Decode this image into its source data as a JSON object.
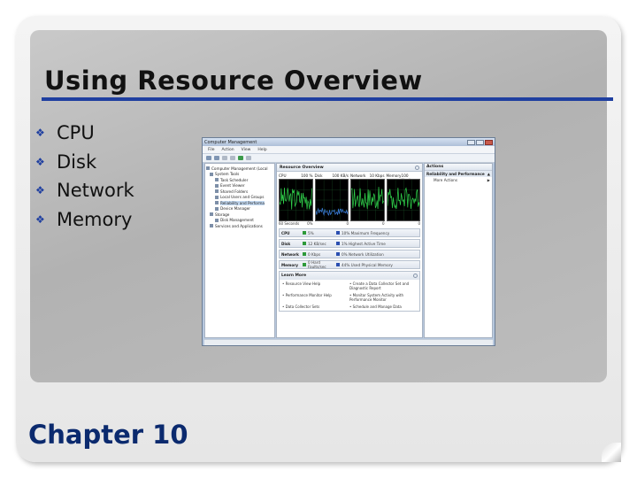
{
  "slide": {
    "title": "Using Resource Overview",
    "bullets": [
      "CPU",
      "Disk",
      "Network",
      "Memory"
    ],
    "footer": "Chapter 10"
  },
  "window": {
    "title": "Computer Management",
    "menus": [
      "File",
      "Action",
      "View",
      "Help"
    ],
    "tree": [
      {
        "label": "Computer Management (Local",
        "level": 0
      },
      {
        "label": "System Tools",
        "level": 1
      },
      {
        "label": "Task Scheduler",
        "level": 2
      },
      {
        "label": "Event Viewer",
        "level": 2
      },
      {
        "label": "Shared Folders",
        "level": 2
      },
      {
        "label": "Local Users and Groups",
        "level": 2
      },
      {
        "label": "Reliability and Performa",
        "level": 2,
        "selected": true
      },
      {
        "label": "Device Manager",
        "level": 2
      },
      {
        "label": "Storage",
        "level": 1
      },
      {
        "label": "Disk Management",
        "level": 2
      },
      {
        "label": "Services and Applications",
        "level": 1
      }
    ],
    "overview": {
      "header": "Resource Overview",
      "graphs": [
        {
          "name": "CPU",
          "value": "100 %",
          "foot_left": "60 Seconds",
          "foot_right": "0%"
        },
        {
          "name": "Disk",
          "value": "100 KB/s",
          "foot_left": "",
          "foot_right": "0"
        },
        {
          "name": "Network",
          "value": "10 Kbps",
          "foot_left": "",
          "foot_right": "0"
        },
        {
          "name": "Memory",
          "value": "100 Hard...",
          "foot_left": "",
          "foot_right": "0"
        }
      ],
      "rows": [
        {
          "name": "CPU",
          "value": "5%",
          "info": "10% Maximum Frequency",
          "color": "#2e9a3a",
          "info_color": "#2b4fb0"
        },
        {
          "name": "Disk",
          "value": "12 KB/sec",
          "info": "1% Highest Active Time",
          "color": "#2e9a3a",
          "info_color": "#2b4fb0"
        },
        {
          "name": "Network",
          "value": "0 Kbps",
          "info": "0% Network Utilization",
          "color": "#2e9a3a",
          "info_color": "#2b4fb0"
        },
        {
          "name": "Memory",
          "value": "0 Hard Faults/sec",
          "info": "44% Used Physical Memory",
          "color": "#2e9a3a",
          "info_color": "#2b4fb0"
        }
      ],
      "learn_more": {
        "header": "Learn More",
        "links": [
          "Resource View Help",
          "Create a Data Collector Set and Diagnostic Report",
          "Performance Monitor Help",
          "Monitor System Activity with Performance Monitor",
          "Data Collector Sets",
          "Schedule and Manage Data"
        ]
      }
    },
    "actions": {
      "header": "Actions",
      "section": "Reliability and Performance",
      "items": [
        "More Actions"
      ]
    }
  }
}
